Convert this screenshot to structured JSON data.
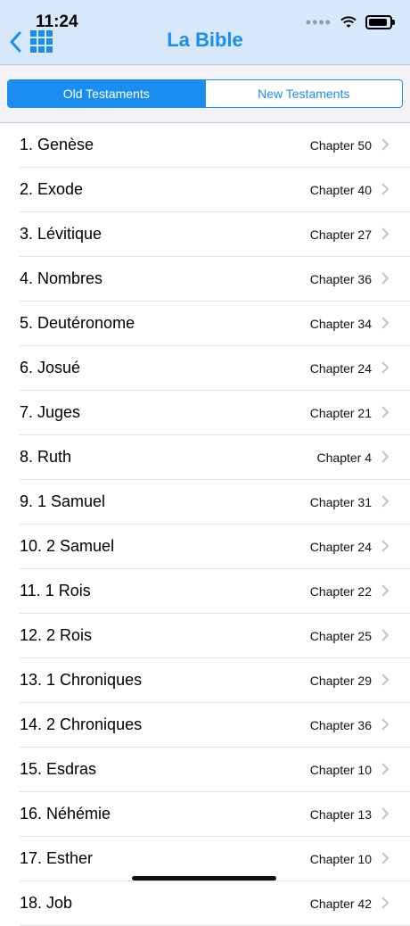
{
  "status": {
    "time": "11:24"
  },
  "header": {
    "title": "La Bible"
  },
  "tabs": [
    {
      "label": "Old Testaments",
      "active": true
    },
    {
      "label": "New Testaments",
      "active": false
    }
  ],
  "books": [
    {
      "name": "1. Genèse",
      "chapter": "Chapter 50"
    },
    {
      "name": "2. Exode",
      "chapter": "Chapter 40"
    },
    {
      "name": "3. Lévitique",
      "chapter": "Chapter 27"
    },
    {
      "name": "4. Nombres",
      "chapter": "Chapter 36"
    },
    {
      "name": "5. Deutéronome",
      "chapter": "Chapter 34"
    },
    {
      "name": "6. Josué",
      "chapter": "Chapter 24"
    },
    {
      "name": "7. Juges",
      "chapter": "Chapter 21"
    },
    {
      "name": "8. Ruth",
      "chapter": "Chapter 4"
    },
    {
      "name": "9. 1 Samuel",
      "chapter": "Chapter 31"
    },
    {
      "name": "10. 2 Samuel",
      "chapter": "Chapter 24"
    },
    {
      "name": "11. 1 Rois",
      "chapter": "Chapter 22"
    },
    {
      "name": "12. 2 Rois",
      "chapter": "Chapter 25"
    },
    {
      "name": "13. 1 Chroniques",
      "chapter": "Chapter 29"
    },
    {
      "name": "14. 2 Chroniques",
      "chapter": "Chapter 36"
    },
    {
      "name": "15. Esdras",
      "chapter": "Chapter 10"
    },
    {
      "name": "16. Néhémie",
      "chapter": "Chapter 13"
    },
    {
      "name": "17. Esther",
      "chapter": "Chapter 10"
    },
    {
      "name": "18. Job",
      "chapter": "Chapter 42"
    }
  ],
  "colors": {
    "accent": "#1a8ef0",
    "header_bg": "#d8e8fb"
  },
  "icons": [
    "back-chevron-icon",
    "grid-menu-icon",
    "wifi-icon",
    "battery-icon",
    "chevron-right-icon"
  ]
}
